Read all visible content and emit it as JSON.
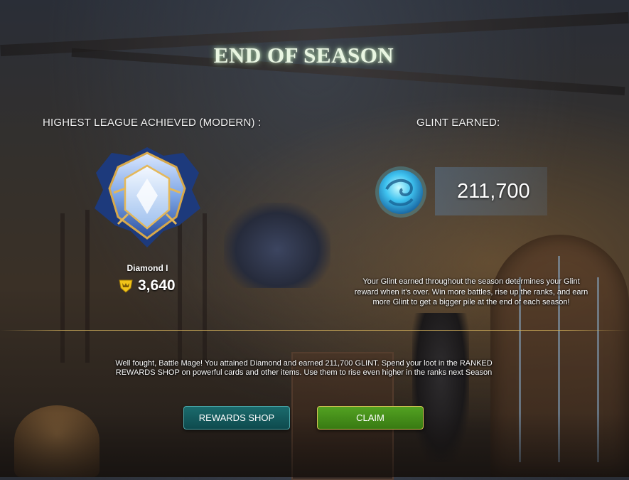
{
  "screen": {
    "title": "END OF SEASON"
  },
  "league": {
    "label": "HIGHEST LEAGUE ACHIEVED (MODERN) :",
    "name": "Diamond I",
    "rating": "3,640",
    "badge_icon": "diamond-league-badge",
    "rating_icon": "rating-trophy-icon"
  },
  "glint": {
    "label": "GLINT EARNED:",
    "value": "211,700",
    "icon": "glint-orb",
    "description": "Your Glint earned throughout the season determines your Glint reward when it's over. Win more battles, rise up the ranks, and earn more Glint to get a bigger pile at the end of each season!"
  },
  "message": "Well fought, Battle Mage! You attained Diamond and earned 211,700 GLINT. Spend your loot in the RANKED REWARDS SHOP on powerful cards and other items. Use them to rise even higher in the ranks next Season",
  "buttons": {
    "rewards_shop": "REWARDS SHOP",
    "claim": "CLAIM"
  },
  "colors": {
    "title_glow": "#bfffaa",
    "rewards_button": "#1b6b6d",
    "claim_button": "#53a222",
    "claim_border": "#d5c254",
    "divider": "#d2af5a"
  }
}
